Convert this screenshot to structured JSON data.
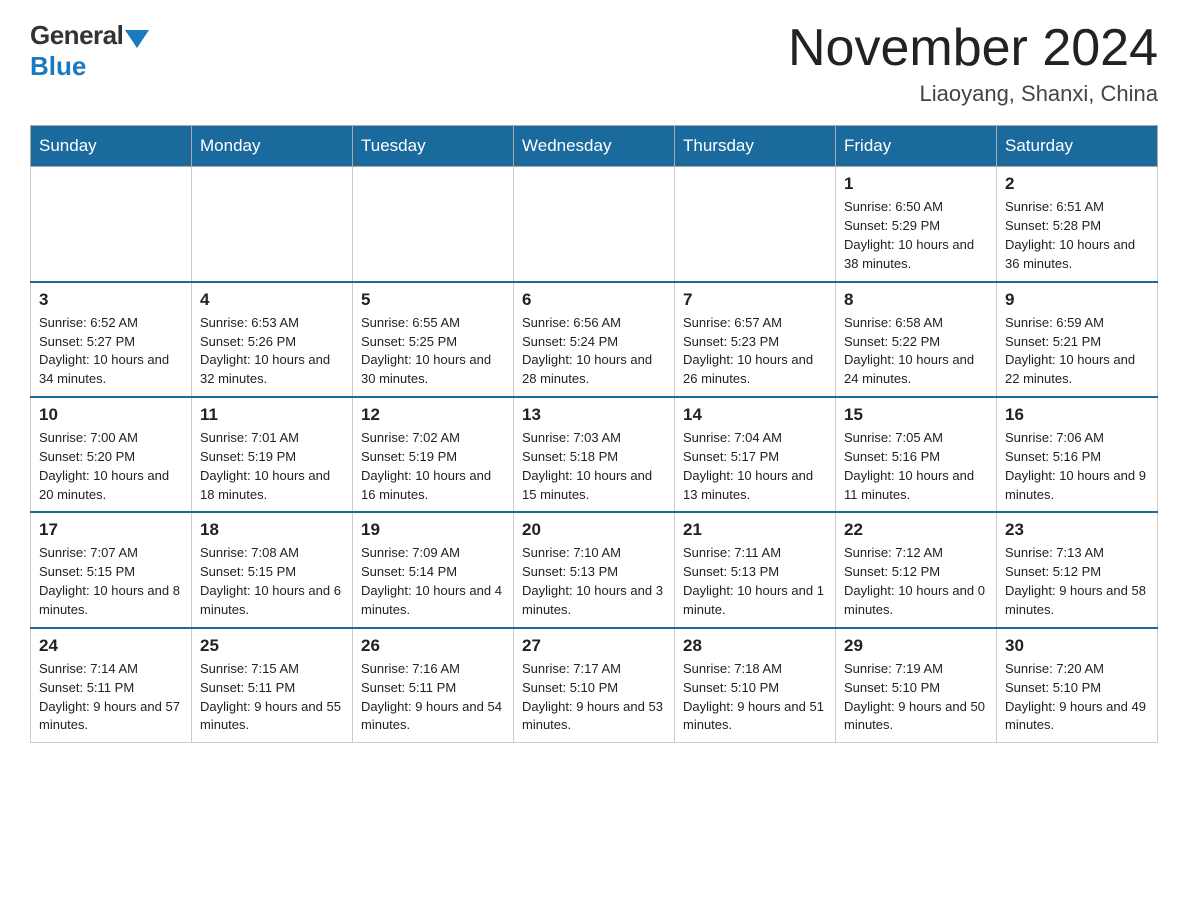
{
  "header": {
    "logo_general": "General",
    "logo_blue": "Blue",
    "title": "November 2024",
    "location": "Liaoyang, Shanxi, China"
  },
  "weekdays": [
    "Sunday",
    "Monday",
    "Tuesday",
    "Wednesday",
    "Thursday",
    "Friday",
    "Saturday"
  ],
  "rows": [
    [
      {
        "day": "",
        "info": ""
      },
      {
        "day": "",
        "info": ""
      },
      {
        "day": "",
        "info": ""
      },
      {
        "day": "",
        "info": ""
      },
      {
        "day": "",
        "info": ""
      },
      {
        "day": "1",
        "info": "Sunrise: 6:50 AM\nSunset: 5:29 PM\nDaylight: 10 hours and 38 minutes."
      },
      {
        "day": "2",
        "info": "Sunrise: 6:51 AM\nSunset: 5:28 PM\nDaylight: 10 hours and 36 minutes."
      }
    ],
    [
      {
        "day": "3",
        "info": "Sunrise: 6:52 AM\nSunset: 5:27 PM\nDaylight: 10 hours and 34 minutes."
      },
      {
        "day": "4",
        "info": "Sunrise: 6:53 AM\nSunset: 5:26 PM\nDaylight: 10 hours and 32 minutes."
      },
      {
        "day": "5",
        "info": "Sunrise: 6:55 AM\nSunset: 5:25 PM\nDaylight: 10 hours and 30 minutes."
      },
      {
        "day": "6",
        "info": "Sunrise: 6:56 AM\nSunset: 5:24 PM\nDaylight: 10 hours and 28 minutes."
      },
      {
        "day": "7",
        "info": "Sunrise: 6:57 AM\nSunset: 5:23 PM\nDaylight: 10 hours and 26 minutes."
      },
      {
        "day": "8",
        "info": "Sunrise: 6:58 AM\nSunset: 5:22 PM\nDaylight: 10 hours and 24 minutes."
      },
      {
        "day": "9",
        "info": "Sunrise: 6:59 AM\nSunset: 5:21 PM\nDaylight: 10 hours and 22 minutes."
      }
    ],
    [
      {
        "day": "10",
        "info": "Sunrise: 7:00 AM\nSunset: 5:20 PM\nDaylight: 10 hours and 20 minutes."
      },
      {
        "day": "11",
        "info": "Sunrise: 7:01 AM\nSunset: 5:19 PM\nDaylight: 10 hours and 18 minutes."
      },
      {
        "day": "12",
        "info": "Sunrise: 7:02 AM\nSunset: 5:19 PM\nDaylight: 10 hours and 16 minutes."
      },
      {
        "day": "13",
        "info": "Sunrise: 7:03 AM\nSunset: 5:18 PM\nDaylight: 10 hours and 15 minutes."
      },
      {
        "day": "14",
        "info": "Sunrise: 7:04 AM\nSunset: 5:17 PM\nDaylight: 10 hours and 13 minutes."
      },
      {
        "day": "15",
        "info": "Sunrise: 7:05 AM\nSunset: 5:16 PM\nDaylight: 10 hours and 11 minutes."
      },
      {
        "day": "16",
        "info": "Sunrise: 7:06 AM\nSunset: 5:16 PM\nDaylight: 10 hours and 9 minutes."
      }
    ],
    [
      {
        "day": "17",
        "info": "Sunrise: 7:07 AM\nSunset: 5:15 PM\nDaylight: 10 hours and 8 minutes."
      },
      {
        "day": "18",
        "info": "Sunrise: 7:08 AM\nSunset: 5:15 PM\nDaylight: 10 hours and 6 minutes."
      },
      {
        "day": "19",
        "info": "Sunrise: 7:09 AM\nSunset: 5:14 PM\nDaylight: 10 hours and 4 minutes."
      },
      {
        "day": "20",
        "info": "Sunrise: 7:10 AM\nSunset: 5:13 PM\nDaylight: 10 hours and 3 minutes."
      },
      {
        "day": "21",
        "info": "Sunrise: 7:11 AM\nSunset: 5:13 PM\nDaylight: 10 hours and 1 minute."
      },
      {
        "day": "22",
        "info": "Sunrise: 7:12 AM\nSunset: 5:12 PM\nDaylight: 10 hours and 0 minutes."
      },
      {
        "day": "23",
        "info": "Sunrise: 7:13 AM\nSunset: 5:12 PM\nDaylight: 9 hours and 58 minutes."
      }
    ],
    [
      {
        "day": "24",
        "info": "Sunrise: 7:14 AM\nSunset: 5:11 PM\nDaylight: 9 hours and 57 minutes."
      },
      {
        "day": "25",
        "info": "Sunrise: 7:15 AM\nSunset: 5:11 PM\nDaylight: 9 hours and 55 minutes."
      },
      {
        "day": "26",
        "info": "Sunrise: 7:16 AM\nSunset: 5:11 PM\nDaylight: 9 hours and 54 minutes."
      },
      {
        "day": "27",
        "info": "Sunrise: 7:17 AM\nSunset: 5:10 PM\nDaylight: 9 hours and 53 minutes."
      },
      {
        "day": "28",
        "info": "Sunrise: 7:18 AM\nSunset: 5:10 PM\nDaylight: 9 hours and 51 minutes."
      },
      {
        "day": "29",
        "info": "Sunrise: 7:19 AM\nSunset: 5:10 PM\nDaylight: 9 hours and 50 minutes."
      },
      {
        "day": "30",
        "info": "Sunrise: 7:20 AM\nSunset: 5:10 PM\nDaylight: 9 hours and 49 minutes."
      }
    ]
  ]
}
